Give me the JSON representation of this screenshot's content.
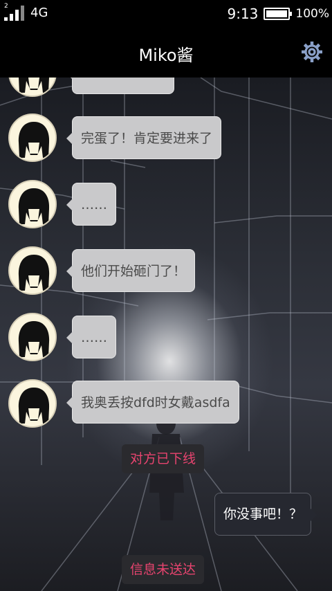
{
  "status_bar": {
    "sim_label": "2",
    "network": "4G",
    "time": "9:13",
    "battery_percent": "100%",
    "battery_level": 1.0
  },
  "header": {
    "title": "Miko酱",
    "settings_icon": "gear-icon"
  },
  "messages": [
    {
      "side": "left",
      "text": "完蛋了！肯定要进来了"
    },
    {
      "side": "left",
      "text": "……"
    },
    {
      "side": "left",
      "text": "他们开始砸门了！"
    },
    {
      "side": "left",
      "text": "……"
    },
    {
      "side": "left",
      "text": "我奥丢按dfd时女戴asdfa"
    }
  ],
  "system_notice_1": "对方已下线",
  "sent_message": "你没事吧！？",
  "system_notice_2": "信息未送达",
  "colors": {
    "bubble_incoming": "#c9c9cb",
    "bubble_outgoing": "#262830",
    "system_text": "#e8446f",
    "settings_icon": "#8aa0c8"
  }
}
